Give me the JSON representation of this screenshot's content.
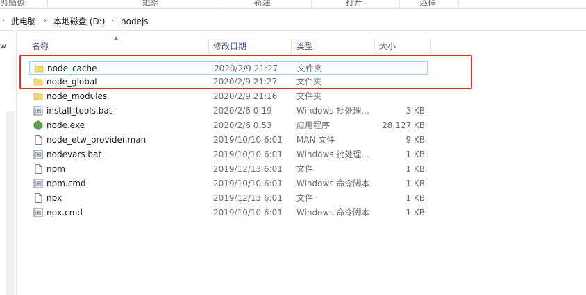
{
  "ribbon": {
    "groups": [
      "剪贴板",
      "组织",
      "新建",
      "打开",
      "选择"
    ]
  },
  "address": {
    "crumbs": [
      "此电脑",
      "本地磁盘 (D:)",
      "nodejs"
    ]
  },
  "nav": {
    "truncated_label": "w"
  },
  "columns": {
    "name": "名称",
    "date": "修改日期",
    "type": "类型",
    "size": "大小"
  },
  "files": [
    {
      "name": "node_cache",
      "date": "2020/2/9 21:27",
      "type": "文件夹",
      "size": "",
      "icon": "folder-icon",
      "selected": true
    },
    {
      "name": "node_global",
      "date": "2020/2/9 21:27",
      "type": "文件夹",
      "size": "",
      "icon": "folder-icon",
      "selected": false
    },
    {
      "name": "node_modules",
      "date": "2020/2/9 21:16",
      "type": "文件夹",
      "size": "",
      "icon": "folder-icon",
      "selected": false
    },
    {
      "name": "install_tools.bat",
      "date": "2020/2/6 0:19",
      "type": "Windows 批处理...",
      "size": "3 KB",
      "icon": "batch-file-icon",
      "selected": false
    },
    {
      "name": "node.exe",
      "date": "2020/2/6 0:53",
      "type": "应用程序",
      "size": "28,127 KB",
      "icon": "nodejs-hexagon-icon",
      "selected": false
    },
    {
      "name": "node_etw_provider.man",
      "date": "2019/10/10 6:01",
      "type": "MAN 文件",
      "size": "9 KB",
      "icon": "file-icon",
      "selected": false
    },
    {
      "name": "nodevars.bat",
      "date": "2019/10/10 6:01",
      "type": "Windows 批处理...",
      "size": "1 KB",
      "icon": "batch-file-icon",
      "selected": false
    },
    {
      "name": "npm",
      "date": "2019/12/13 6:01",
      "type": "文件",
      "size": "1 KB",
      "icon": "file-icon",
      "selected": false
    },
    {
      "name": "npm.cmd",
      "date": "2019/10/10 6:01",
      "type": "Windows 命令脚本",
      "size": "1 KB",
      "icon": "batch-file-icon",
      "selected": false
    },
    {
      "name": "npx",
      "date": "2019/12/13 6:01",
      "type": "文件",
      "size": "1 KB",
      "icon": "file-icon",
      "selected": false
    },
    {
      "name": "npx.cmd",
      "date": "2019/10/10 6:01",
      "type": "Windows 命令脚本",
      "size": "1 KB",
      "icon": "batch-file-icon",
      "selected": false
    }
  ],
  "colors": {
    "highlight": "#e52a2a",
    "folder": "#f8d775",
    "selection_border": "#99d1ff",
    "node_green": "#5fa04e"
  }
}
